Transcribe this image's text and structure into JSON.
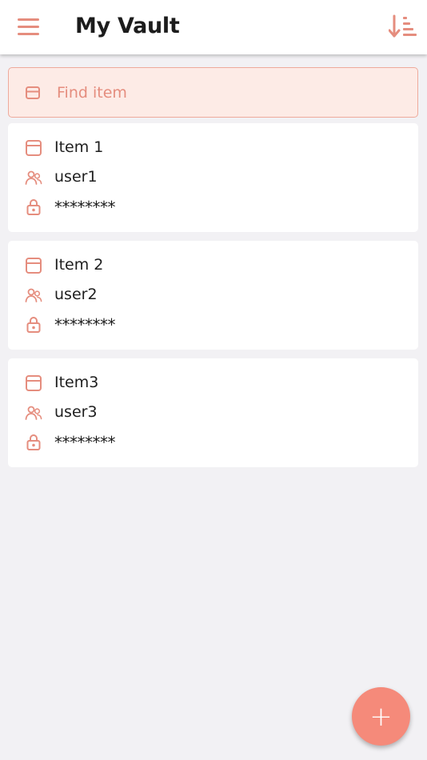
{
  "header": {
    "title": "My Vault",
    "menu_icon": "hamburger-menu-icon",
    "sort_icon": "sort-descending-icon"
  },
  "search": {
    "placeholder": "Find item",
    "value": "",
    "icon": "browser-window-icon"
  },
  "items": [
    {
      "name": "Item 1",
      "username": "user1",
      "password": "********"
    },
    {
      "name": "Item 2",
      "username": "user2",
      "password": "********"
    },
    {
      "name": "Item3",
      "username": "user3",
      "password": "********"
    }
  ],
  "item_icons": {
    "name": "browser-window-icon",
    "username": "users-icon",
    "password": "lock-icon"
  },
  "fab": {
    "label": "+",
    "icon": "plus-icon"
  },
  "colors": {
    "accent": "#f58a7a",
    "accent_icon": "#e58d7e",
    "search_bg": "#fdebe6",
    "page_bg": "#f2f1f4",
    "card_bg": "#ffffff"
  }
}
